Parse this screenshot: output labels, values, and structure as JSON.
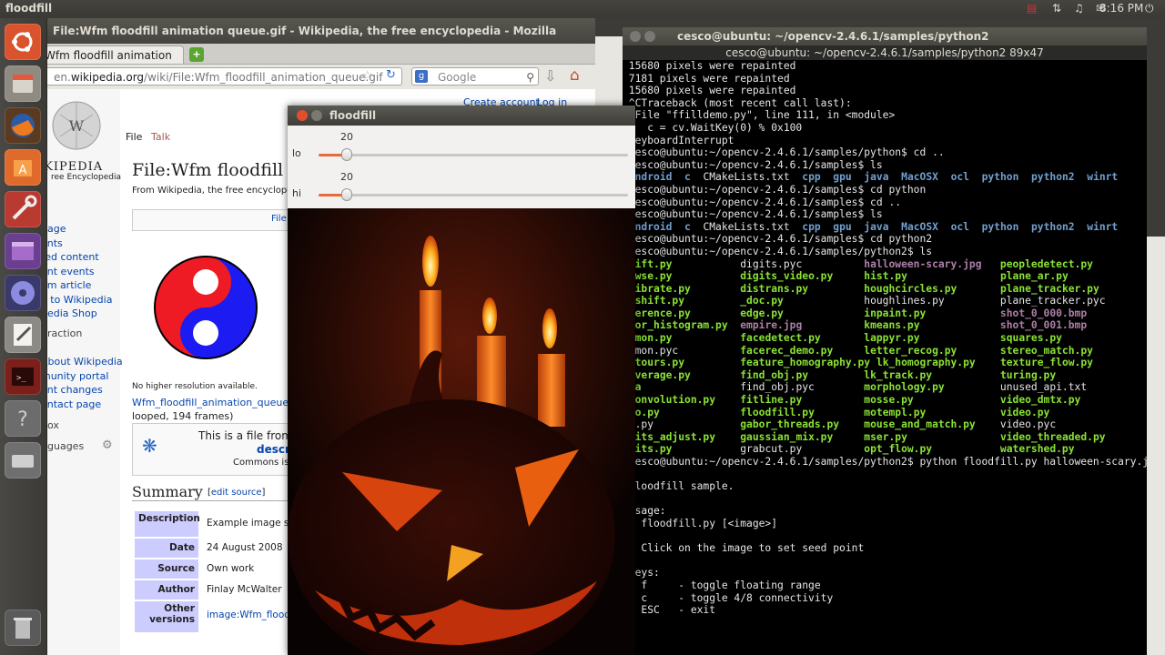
{
  "top_panel": {
    "app_title": "floodfill",
    "clock": "8:16 PM"
  },
  "launcher": {
    "items": [
      "ubuntu-home",
      "files",
      "firefox",
      "software-center",
      "system-settings",
      "workspaces",
      "disc",
      "text-editor",
      "terminal",
      "help",
      "drive",
      "trash"
    ]
  },
  "firefox": {
    "window_title": "File:Wfm floodfill animation queue.gif - Wikipedia, the free encyclopedia - Mozilla Firefox",
    "tab_label": "Wfm floodfill animation q...",
    "url_prefix": "en.",
    "url_domain": "wikipedia.org",
    "url_path": "/wiki/File:Wfm_floodfill_animation_queue.gif",
    "search_placeholder": "Google",
    "create_account": "Create account",
    "log_in": "Log in",
    "tab_file": "File",
    "tab_talk": "Talk",
    "heading": "File:Wfm floodfill",
    "subheading": "From Wikipedia, the free encyclopedi",
    "file_button": "File",
    "logo_name": "IKIPEDIA",
    "logo_tag": "ree Encyclopedia",
    "sidebar": [
      "page",
      "ents",
      "red content",
      "ent events",
      "om article",
      "e to Wikipedia",
      "pedia Shop"
    ],
    "interaction": "raction",
    "about": "About Wikipedia",
    "community": "munity portal",
    "changes": "ent changes",
    "contact": "ontact page",
    "toolbox": "ox",
    "languages": "guages",
    "no_higher": "No higher resolution available.",
    "file_link": "Wfm_floodfill_animation_queue.g",
    "frames": "looped, 194 frames)",
    "commons_text": "This is a file from",
    "commons_desc": "descr",
    "commons_label": "Commons is",
    "summary": "Summary",
    "edit_source": "edit source",
    "table": [
      {
        "key": "Description",
        "value": "Example image sh"
      },
      {
        "key": "Date",
        "value": "24 August 2008"
      },
      {
        "key": "Source",
        "value": "Own work"
      },
      {
        "key": "Author",
        "value": "Finlay McWalter"
      },
      {
        "key": "Other versions",
        "value": "image:Wfm_floodf"
      }
    ]
  },
  "terminal": {
    "title": "cesco@ubuntu: ~/opencv-2.4.6.1/samples/python2",
    "subtitle": "cesco@ubuntu: ~/opencv-2.4.6.1/samples/python2 89x47"
  },
  "floodfill": {
    "title": "floodfill",
    "lo_label": "lo",
    "lo_value": "20",
    "hi_label": "hi",
    "hi_value": "20",
    "lo_level": 0.09,
    "hi_level": 0.09
  }
}
